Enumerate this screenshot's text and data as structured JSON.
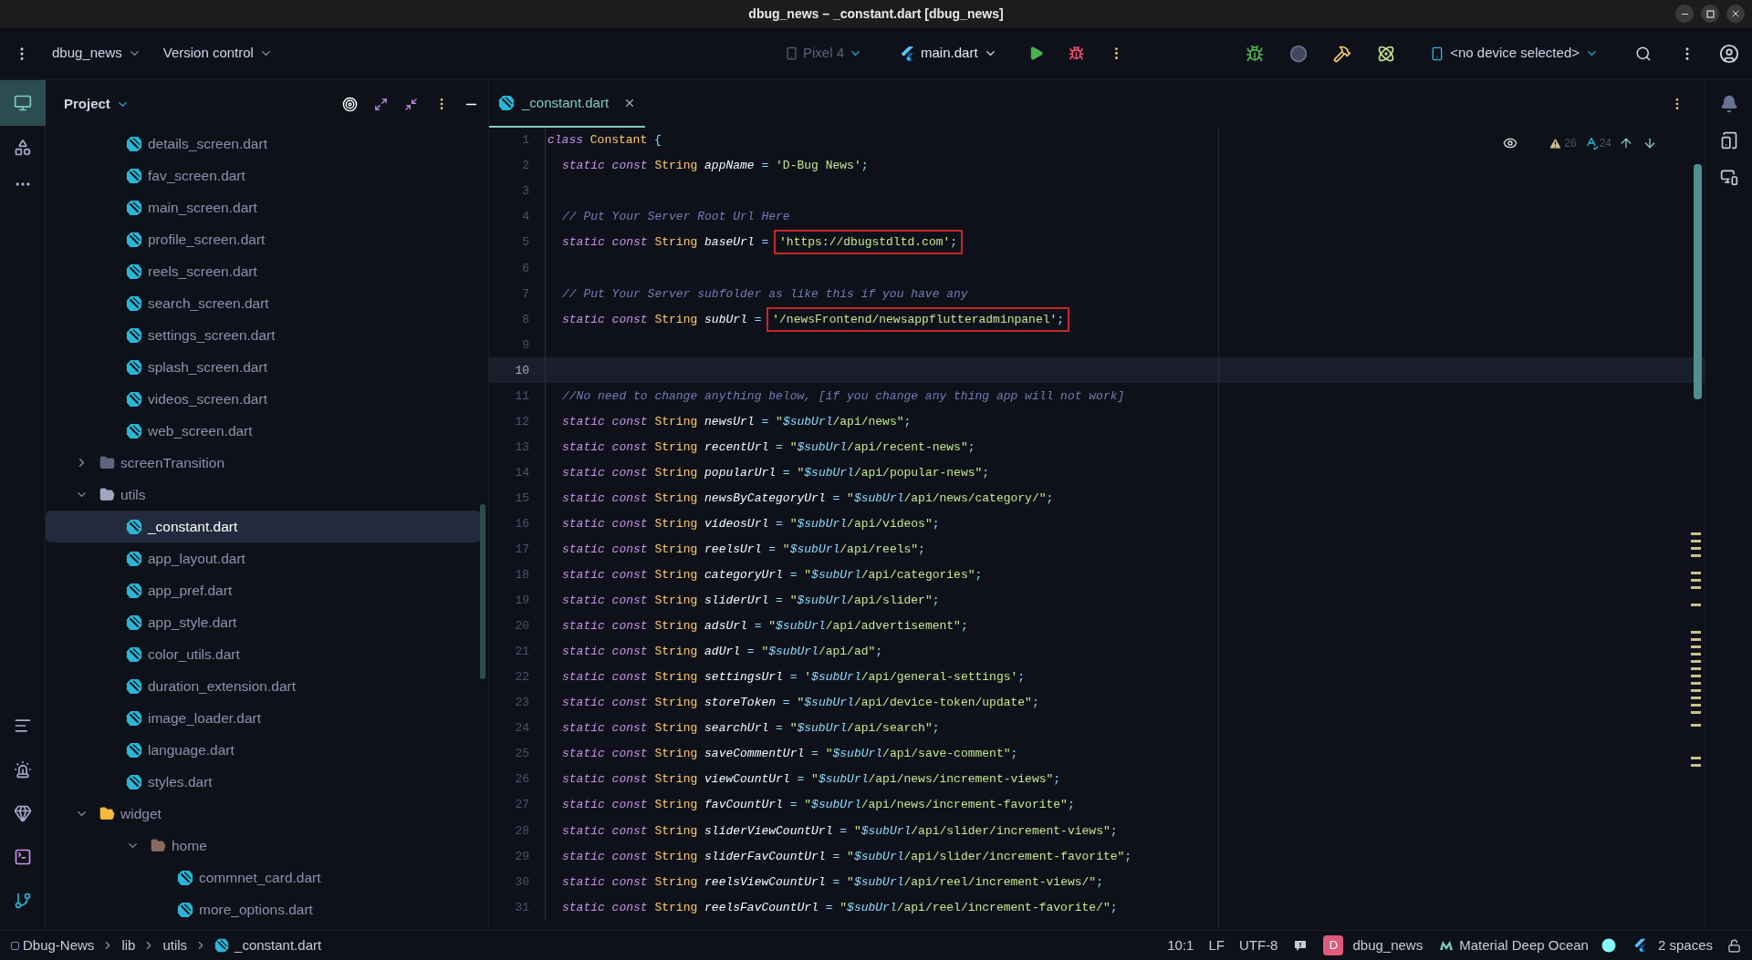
{
  "window": {
    "title": "dbug_news – _constant.dart [dbug_news]"
  },
  "toolbar": {
    "project": "dbug_news",
    "vcs": "Version control",
    "device_config": {
      "label": "Pixel 4",
      "disabled": true
    },
    "run_config": "main.dart",
    "device": "<no device selected>"
  },
  "project_panel": {
    "title": "Project"
  },
  "tree": {
    "files_above": [
      {
        "label": "details_screen.dart",
        "selected": false
      },
      {
        "label": "fav_screen.dart",
        "selected": false
      },
      {
        "label": "main_screen.dart",
        "selected": false
      },
      {
        "label": "profile_screen.dart",
        "selected": false
      },
      {
        "label": "reels_screen.dart",
        "selected": false
      },
      {
        "label": "search_screen.dart",
        "selected": false
      },
      {
        "label": "settings_screen.dart",
        "selected": false
      },
      {
        "label": "splash_screen.dart",
        "selected": false
      },
      {
        "label": "videos_screen.dart",
        "selected": false
      },
      {
        "label": "web_screen.dart",
        "selected": false
      }
    ],
    "items": [
      {
        "label": "screenTransition",
        "kind": "folder",
        "color": "#5c6480",
        "expanded": false,
        "selected": false
      },
      {
        "label": "utils",
        "kind": "folder",
        "color": "#a0a7c0",
        "expanded": true,
        "selected": false,
        "children": [
          {
            "label": "_constant.dart",
            "kind": "file",
            "selected": true
          },
          {
            "label": "app_layout.dart",
            "kind": "file",
            "selected": false
          },
          {
            "label": "app_pref.dart",
            "kind": "file",
            "selected": false
          },
          {
            "label": "app_style.dart",
            "kind": "file",
            "selected": false
          },
          {
            "label": "color_utils.dart",
            "kind": "file",
            "selected": false
          },
          {
            "label": "duration_extension.dart",
            "kind": "file",
            "selected": false
          },
          {
            "label": "image_loader.dart",
            "kind": "file",
            "selected": false
          },
          {
            "label": "language.dart",
            "kind": "file",
            "selected": false
          },
          {
            "label": "styles.dart",
            "kind": "file",
            "selected": false
          }
        ]
      },
      {
        "label": "widget",
        "kind": "folder",
        "color": "#f5b93a",
        "expanded": true,
        "selected": false,
        "children": [
          {
            "label": "home",
            "kind": "folder",
            "color": "#8a6a5e",
            "expanded": true,
            "selected": false,
            "children": [
              {
                "label": "commnet_card.dart",
                "kind": "file",
                "selected": false
              },
              {
                "label": "more_options.dart",
                "kind": "file",
                "selected": false
              }
            ]
          }
        ]
      }
    ]
  },
  "tabs": [
    {
      "label": "_constant.dart",
      "selected": true
    }
  ],
  "inspections": {
    "warnings": "26",
    "typos": "24"
  },
  "code": [
    {
      "number": "1",
      "kind": "top",
      "current": false,
      "tokens": [
        {
          "kind": "kw",
          "text": "class "
        },
        {
          "kind": "type",
          "text": "Constant "
        },
        {
          "kind": "op",
          "text": "{"
        }
      ]
    },
    {
      "number": "2",
      "kind": "member",
      "current": false,
      "tokens": [
        {
          "kind": "kw",
          "text": "static const "
        },
        {
          "kind": "type",
          "text": "String "
        },
        {
          "kind": "id",
          "text": "appName "
        },
        {
          "kind": "op",
          "text": "= "
        },
        {
          "kind": "str",
          "text": "'D-Bug News'"
        },
        {
          "kind": "op",
          "text": ";"
        }
      ]
    },
    {
      "number": "3",
      "kind": "member",
      "current": false
    },
    {
      "number": "4",
      "kind": "member",
      "current": false,
      "tokens": [
        {
          "kind": "cm",
          "text": "// Put Your Server Root Url Here"
        }
      ]
    },
    {
      "number": "5",
      "kind": "member",
      "current": false,
      "tokens": [
        {
          "kind": "kw",
          "text": "static const "
        },
        {
          "kind": "type",
          "text": "String "
        },
        {
          "kind": "id",
          "text": "baseUrl "
        },
        {
          "kind": "op",
          "text": "= "
        },
        {
          "kind": "box",
          "tokens": [
            {
              "kind": "str",
              "text": "'https://dbugstdltd.com'"
            },
            {
              "kind": "op",
              "text": ";"
            }
          ]
        }
      ]
    },
    {
      "number": "6",
      "kind": "member",
      "current": false
    },
    {
      "number": "7",
      "kind": "member",
      "current": false,
      "tokens": [
        {
          "kind": "cm",
          "text": "// Put Your Server subfolder as like this if you have any"
        }
      ]
    },
    {
      "number": "8",
      "kind": "member",
      "current": false,
      "tokens": [
        {
          "kind": "kw",
          "text": "static const "
        },
        {
          "kind": "type",
          "text": "String "
        },
        {
          "kind": "id",
          "text": "subUrl "
        },
        {
          "kind": "op",
          "text": "= "
        },
        {
          "kind": "box",
          "tokens": [
            {
              "kind": "str",
              "text": "'/newsFrontend/newsappflutteradminpanel'"
            },
            {
              "kind": "op",
              "text": ";"
            }
          ]
        }
      ]
    },
    {
      "number": "9",
      "kind": "member",
      "current": false
    },
    {
      "number": "10",
      "kind": "member",
      "current": true
    },
    {
      "number": "11",
      "kind": "member",
      "current": false,
      "tokens": [
        {
          "kind": "cm",
          "text": "//No need to change anything below, [if you change any thing app will not work]"
        }
      ]
    },
    {
      "number": "12",
      "kind": "member",
      "current": false,
      "tokens": [
        {
          "kind": "kw",
          "text": "static const "
        },
        {
          "kind": "type",
          "text": "String "
        },
        {
          "kind": "id",
          "text": "newsUrl "
        },
        {
          "kind": "op",
          "text": "= "
        },
        {
          "kind": "str",
          "text": "\""
        },
        {
          "kind": "var",
          "text": "$subUrl"
        },
        {
          "kind": "str",
          "text": "/api/news\""
        },
        {
          "kind": "op",
          "text": ";"
        }
      ]
    },
    {
      "number": "13",
      "kind": "member",
      "current": false,
      "tokens": [
        {
          "kind": "kw",
          "text": "static const "
        },
        {
          "kind": "type",
          "text": "String "
        },
        {
          "kind": "id",
          "text": "recentUrl "
        },
        {
          "kind": "op",
          "text": "= "
        },
        {
          "kind": "str",
          "text": "\""
        },
        {
          "kind": "var",
          "text": "$subUrl"
        },
        {
          "kind": "str",
          "text": "/api/recent-news\""
        },
        {
          "kind": "op",
          "text": ";"
        }
      ]
    },
    {
      "number": "14",
      "kind": "member",
      "current": false,
      "tokens": [
        {
          "kind": "kw",
          "text": "static const "
        },
        {
          "kind": "type",
          "text": "String "
        },
        {
          "kind": "id",
          "text": "popularUrl "
        },
        {
          "kind": "op",
          "text": "= "
        },
        {
          "kind": "str",
          "text": "\""
        },
        {
          "kind": "var",
          "text": "$subUrl"
        },
        {
          "kind": "str",
          "text": "/api/popular-news\""
        },
        {
          "kind": "op",
          "text": ";"
        }
      ]
    },
    {
      "number": "15",
      "kind": "member",
      "current": false,
      "tokens": [
        {
          "kind": "kw",
          "text": "static const "
        },
        {
          "kind": "type",
          "text": "String "
        },
        {
          "kind": "id",
          "text": "newsByCategoryUrl "
        },
        {
          "kind": "op",
          "text": "= "
        },
        {
          "kind": "str",
          "text": "\""
        },
        {
          "kind": "var",
          "text": "$subUrl"
        },
        {
          "kind": "str",
          "text": "/api/news/category/\""
        },
        {
          "kind": "op",
          "text": ";"
        }
      ]
    },
    {
      "number": "16",
      "kind": "member",
      "current": false,
      "tokens": [
        {
          "kind": "kw",
          "text": "static const "
        },
        {
          "kind": "type",
          "text": "String "
        },
        {
          "kind": "id",
          "text": "videosUrl "
        },
        {
          "kind": "op",
          "text": "= "
        },
        {
          "kind": "str",
          "text": "\""
        },
        {
          "kind": "var",
          "text": "$subUrl"
        },
        {
          "kind": "str",
          "text": "/api/videos\""
        },
        {
          "kind": "op",
          "text": ";"
        }
      ]
    },
    {
      "number": "17",
      "kind": "member",
      "current": false,
      "tokens": [
        {
          "kind": "kw",
          "text": "static const "
        },
        {
          "kind": "type",
          "text": "String "
        },
        {
          "kind": "id",
          "text": "reelsUrl "
        },
        {
          "kind": "op",
          "text": "= "
        },
        {
          "kind": "str",
          "text": "\""
        },
        {
          "kind": "var",
          "text": "$subUrl"
        },
        {
          "kind": "str",
          "text": "/api/reels\""
        },
        {
          "kind": "op",
          "text": ";"
        }
      ]
    },
    {
      "number": "18",
      "kind": "member",
      "current": false,
      "tokens": [
        {
          "kind": "kw",
          "text": "static const "
        },
        {
          "kind": "type",
          "text": "String "
        },
        {
          "kind": "id",
          "text": "categoryUrl "
        },
        {
          "kind": "op",
          "text": "= "
        },
        {
          "kind": "str",
          "text": "\""
        },
        {
          "kind": "var",
          "text": "$subUrl"
        },
        {
          "kind": "str",
          "text": "/api/categories\""
        },
        {
          "kind": "op",
          "text": ";"
        }
      ]
    },
    {
      "number": "19",
      "kind": "member",
      "current": false,
      "tokens": [
        {
          "kind": "kw",
          "text": "static const "
        },
        {
          "kind": "type",
          "text": "String "
        },
        {
          "kind": "id",
          "text": "sliderUrl "
        },
        {
          "kind": "op",
          "text": "= "
        },
        {
          "kind": "str",
          "text": "\""
        },
        {
          "kind": "var",
          "text": "$subUrl"
        },
        {
          "kind": "str",
          "text": "/api/slider\""
        },
        {
          "kind": "op",
          "text": ";"
        }
      ]
    },
    {
      "number": "20",
      "kind": "member",
      "current": false,
      "tokens": [
        {
          "kind": "kw",
          "text": "static const "
        },
        {
          "kind": "type",
          "text": "String "
        },
        {
          "kind": "id",
          "text": "adsUrl "
        },
        {
          "kind": "op",
          "text": "= "
        },
        {
          "kind": "str",
          "text": "\""
        },
        {
          "kind": "var",
          "text": "$subUrl"
        },
        {
          "kind": "str",
          "text": "/api/advertisement\""
        },
        {
          "kind": "op",
          "text": ";"
        }
      ]
    },
    {
      "number": "21",
      "kind": "member",
      "current": false,
      "tokens": [
        {
          "kind": "kw",
          "text": "static const "
        },
        {
          "kind": "type",
          "text": "String "
        },
        {
          "kind": "id",
          "text": "adUrl "
        },
        {
          "kind": "op",
          "text": "= "
        },
        {
          "kind": "str",
          "text": "\""
        },
        {
          "kind": "var",
          "text": "$subUrl"
        },
        {
          "kind": "str",
          "text": "/api/ad\""
        },
        {
          "kind": "op",
          "text": ";"
        }
      ]
    },
    {
      "number": "22",
      "kind": "member",
      "current": false,
      "tokens": [
        {
          "kind": "kw",
          "text": "static const "
        },
        {
          "kind": "type",
          "text": "String "
        },
        {
          "kind": "id",
          "text": "settingsUrl "
        },
        {
          "kind": "op",
          "text": "= "
        },
        {
          "kind": "str",
          "text": "'"
        },
        {
          "kind": "var",
          "text": "$subUrl"
        },
        {
          "kind": "str",
          "text": "/api/general-settings'"
        },
        {
          "kind": "op",
          "text": ";"
        }
      ]
    },
    {
      "number": "23",
      "kind": "member",
      "current": false,
      "tokens": [
        {
          "kind": "kw",
          "text": "static const "
        },
        {
          "kind": "type",
          "text": "String "
        },
        {
          "kind": "id",
          "text": "storeToken "
        },
        {
          "kind": "op",
          "text": "= "
        },
        {
          "kind": "str",
          "text": "\""
        },
        {
          "kind": "var",
          "text": "$subUrl"
        },
        {
          "kind": "str",
          "text": "/api/device-token/update\""
        },
        {
          "kind": "op",
          "text": ";"
        }
      ]
    },
    {
      "number": "24",
      "kind": "member",
      "current": false,
      "tokens": [
        {
          "kind": "kw",
          "text": "static const "
        },
        {
          "kind": "type",
          "text": "String "
        },
        {
          "kind": "id",
          "text": "searchUrl "
        },
        {
          "kind": "op",
          "text": "= "
        },
        {
          "kind": "str",
          "text": "\""
        },
        {
          "kind": "var",
          "text": "$subUrl"
        },
        {
          "kind": "str",
          "text": "/api/search\""
        },
        {
          "kind": "op",
          "text": ";"
        }
      ]
    },
    {
      "number": "25",
      "kind": "member",
      "current": false,
      "tokens": [
        {
          "kind": "kw",
          "text": "static const "
        },
        {
          "kind": "type",
          "text": "String "
        },
        {
          "kind": "id",
          "text": "saveCommentUrl "
        },
        {
          "kind": "op",
          "text": "= "
        },
        {
          "kind": "str",
          "text": "\""
        },
        {
          "kind": "var",
          "text": "$subUrl"
        },
        {
          "kind": "str",
          "text": "/api/save-comment\""
        },
        {
          "kind": "op",
          "text": ";"
        }
      ]
    },
    {
      "number": "26",
      "kind": "member",
      "current": false,
      "tokens": [
        {
          "kind": "kw",
          "text": "static const "
        },
        {
          "kind": "type",
          "text": "String "
        },
        {
          "kind": "id",
          "text": "viewCountUrl "
        },
        {
          "kind": "op",
          "text": "= "
        },
        {
          "kind": "str",
          "text": "\""
        },
        {
          "kind": "var",
          "text": "$subUrl"
        },
        {
          "kind": "str",
          "text": "/api/news/increment-views\""
        },
        {
          "kind": "op",
          "text": ";"
        }
      ]
    },
    {
      "number": "27",
      "kind": "member",
      "current": false,
      "tokens": [
        {
          "kind": "kw",
          "text": "static const "
        },
        {
          "kind": "type",
          "text": "String "
        },
        {
          "kind": "id",
          "text": "favCountUrl "
        },
        {
          "kind": "op",
          "text": "= "
        },
        {
          "kind": "str",
          "text": "\""
        },
        {
          "kind": "var",
          "text": "$subUrl"
        },
        {
          "kind": "str",
          "text": "/api/news/increment-favorite\""
        },
        {
          "kind": "op",
          "text": ";"
        }
      ]
    },
    {
      "number": "28",
      "kind": "member",
      "current": false,
      "tokens": [
        {
          "kind": "kw",
          "text": "static const "
        },
        {
          "kind": "type",
          "text": "String "
        },
        {
          "kind": "id",
          "text": "sliderViewCountUrl "
        },
        {
          "kind": "op",
          "text": "= "
        },
        {
          "kind": "str",
          "text": "\""
        },
        {
          "kind": "var",
          "text": "$subUrl"
        },
        {
          "kind": "str",
          "text": "/api/slider/increment-views\""
        },
        {
          "kind": "op",
          "text": ";"
        }
      ]
    },
    {
      "number": "29",
      "kind": "member",
      "current": false,
      "tokens": [
        {
          "kind": "kw",
          "text": "static const "
        },
        {
          "kind": "type",
          "text": "String "
        },
        {
          "kind": "id",
          "text": "sliderFavCountUrl "
        },
        {
          "kind": "op",
          "text": "= "
        },
        {
          "kind": "str",
          "text": "\""
        },
        {
          "kind": "var",
          "text": "$subUrl"
        },
        {
          "kind": "str",
          "text": "/api/slider/increment-favorite\""
        },
        {
          "kind": "op",
          "text": ";"
        }
      ]
    },
    {
      "number": "30",
      "kind": "member",
      "current": false,
      "tokens": [
        {
          "kind": "kw",
          "text": "static const "
        },
        {
          "kind": "type",
          "text": "String "
        },
        {
          "kind": "id",
          "text": "reelsViewCountUrl "
        },
        {
          "kind": "op",
          "text": "= "
        },
        {
          "kind": "str",
          "text": "\""
        },
        {
          "kind": "var",
          "text": "$subUrl"
        },
        {
          "kind": "str",
          "text": "/api/reel/increment-views/\""
        },
        {
          "kind": "op",
          "text": ";"
        }
      ]
    },
    {
      "number": "31",
      "kind": "member",
      "current": false,
      "tokens": [
        {
          "kind": "kw",
          "text": "static const "
        },
        {
          "kind": "type",
          "text": "String "
        },
        {
          "kind": "id",
          "text": "reelsFavCountUrl "
        },
        {
          "kind": "op",
          "text": "= "
        },
        {
          "kind": "str",
          "text": "\""
        },
        {
          "kind": "var",
          "text": "$subUrl"
        },
        {
          "kind": "str",
          "text": "/api/reel/increment-favorite/\""
        },
        {
          "kind": "op",
          "text": ";"
        }
      ]
    }
  ],
  "status_bar": {
    "breadcrumbs": [
      "Dbug-News",
      "lib",
      "utils",
      "_constant.dart"
    ],
    "position": "10:1",
    "line_separator": "LF",
    "encoding": "UTF-8",
    "vcs_badge": "D",
    "vcs_project": "dbug_news",
    "theme": "Material Deep Ocean",
    "indent": "2 spaces"
  }
}
